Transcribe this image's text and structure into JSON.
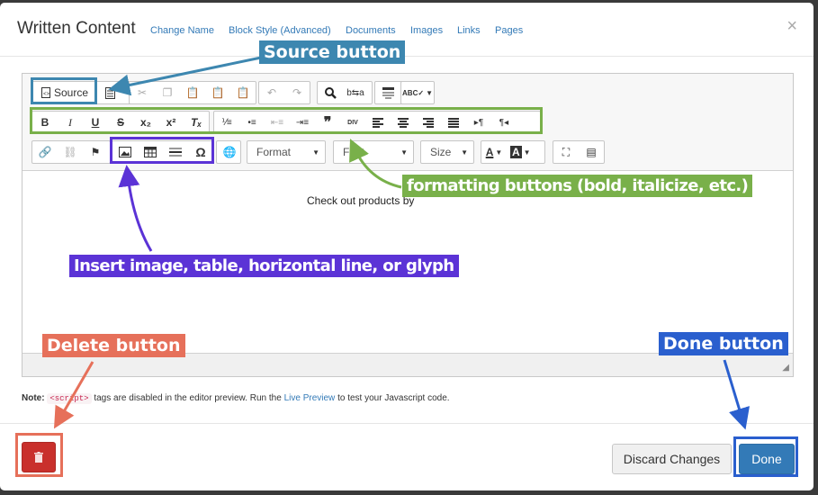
{
  "modal": {
    "title": "Written Content",
    "close": "×",
    "links": [
      "Change Name",
      "Block Style (Advanced)",
      "Documents",
      "Images",
      "Links",
      "Pages"
    ]
  },
  "toolbar": {
    "source_label": "Source",
    "format_label": "Format",
    "font_label": "Font",
    "size_label": "Size"
  },
  "editor": {
    "content_text": "Check out products by"
  },
  "note": {
    "prefix": "Note:",
    "code": "<script>",
    "middle": " tags are disabled in the editor preview. Run the ",
    "link": "Live Preview",
    "suffix": " to test your Javascript code."
  },
  "footer": {
    "discard": "Discard Changes",
    "done": "Done"
  },
  "annotations": {
    "source": "Source button",
    "formatting": "formatting buttons (bold, italicize, etc.)",
    "insert": "Insert image, table, horizontal line, or glyph",
    "delete": "Delete button",
    "done": "Done button"
  },
  "colors": {
    "source": "#3d87b0",
    "formatting": "#79b04a",
    "insert": "#5b33d6",
    "delete": "#e6705a",
    "done": "#2a5fce",
    "primary": "#337ab7",
    "danger": "#c9302c"
  }
}
